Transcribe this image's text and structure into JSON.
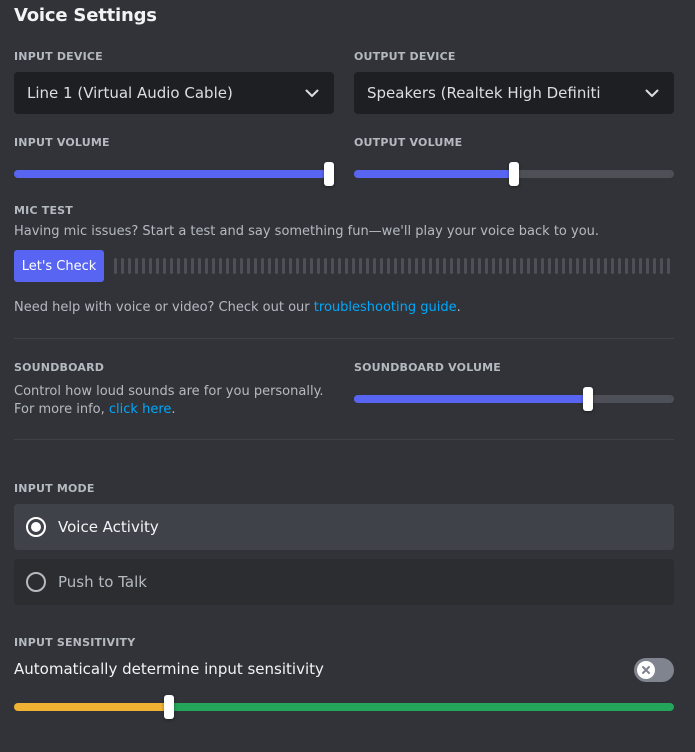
{
  "title": "Voice Settings",
  "input_device": {
    "label": "INPUT DEVICE",
    "value": "Line 1 (Virtual Audio Cable)"
  },
  "output_device": {
    "label": "OUTPUT DEVICE",
    "value": "Speakers (Realtek High Definiti"
  },
  "input_volume": {
    "label": "INPUT VOLUME",
    "level": 1.0
  },
  "output_volume": {
    "label": "OUTPUT VOLUME",
    "level": 0.5
  },
  "mic_test": {
    "label": "MIC TEST",
    "description": "Having mic issues? Start a test and say something fun—we'll play your voice back to you.",
    "button": "Let's Check"
  },
  "help": {
    "prefix": "Need help with voice or video? Check out our ",
    "link": "troubleshooting guide",
    "suffix": "."
  },
  "soundboard": {
    "label": "SOUNDBOARD",
    "description": "Control how loud sounds are for you personally. For more info, ",
    "link": "click here",
    "suffix": ".",
    "volume_label": "SOUNDBOARD VOLUME",
    "volume_level": 0.74
  },
  "input_mode": {
    "label": "INPUT MODE",
    "options": [
      {
        "label": "Voice Activity",
        "selected": true
      },
      {
        "label": "Push to Talk",
        "selected": false
      }
    ]
  },
  "input_sensitivity": {
    "label": "INPUT SENSITIVITY",
    "auto_label": "Automatically determine input sensitivity",
    "auto_enabled": false,
    "threshold": 0.23
  },
  "colors": {
    "accent": "#5865f2",
    "link": "#00a8fc",
    "sensitivity_low": "#f0b232",
    "sensitivity_high": "#23a55a"
  },
  "icons": [
    "chevron-down-icon",
    "close-icon",
    "radio-selected-icon",
    "radio-unselected-icon"
  ]
}
